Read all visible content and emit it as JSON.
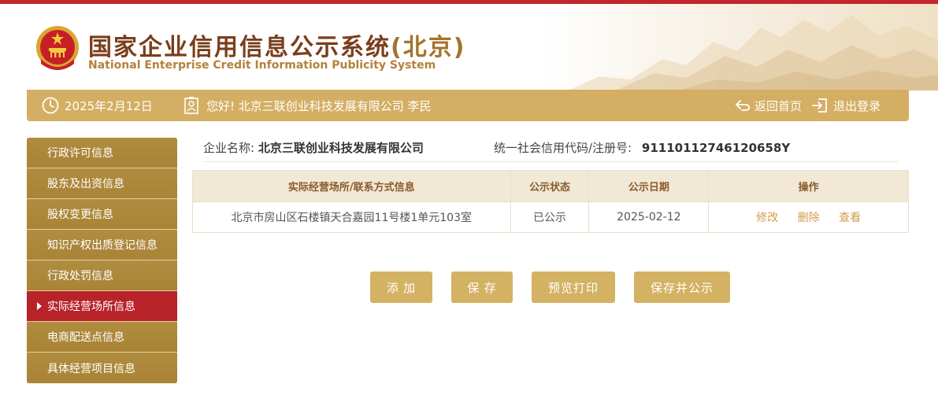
{
  "header": {
    "title_cn": "国家企业信用信息公示系统",
    "title_region": "(北京)",
    "title_en": "National Enterprise Credit Information Publicity System"
  },
  "topbar": {
    "date": "2025年2月12日",
    "greeting": "您好! 北京三联创业科技发展有限公司  李民",
    "back_home": "返回首页",
    "logout": "退出登录"
  },
  "sidebar": {
    "items": [
      {
        "label": "行政许可信息"
      },
      {
        "label": "股东及出资信息"
      },
      {
        "label": "股权变更信息"
      },
      {
        "label": "知识产权出质登记信息"
      },
      {
        "label": "行政处罚信息"
      },
      {
        "label": "实际经营场所信息",
        "active": true
      },
      {
        "label": "电商配送点信息"
      },
      {
        "label": "具体经营项目信息"
      }
    ]
  },
  "company": {
    "name_label": "企业名称:",
    "name_value": "北京三联创业科技发展有限公司",
    "code_label": "统一社会信用代码/注册号:",
    "code_value": "91110112746120658Y"
  },
  "table": {
    "headers": [
      "实际经营场所/联系方式信息",
      "公示状态",
      "公示日期",
      "操作"
    ],
    "rows": [
      {
        "address": "北京市房山区石楼镇天合嘉园11号楼1单元103室",
        "status": "已公示",
        "date": "2025-02-12"
      }
    ],
    "actions": {
      "edit": "修改",
      "delete": "删除",
      "view": "查看"
    }
  },
  "buttons": {
    "add": "添 加",
    "save": "保 存",
    "preview_print": "预览打印",
    "save_publish": "保存并公示"
  },
  "colors": {
    "accent_red": "#c1272d",
    "gold_bar": "#d4ae62",
    "sidebar_bg": "#b08c3f",
    "sidebar_active": "#b8232a",
    "table_header_bg": "#f1e8d6",
    "link_gold": "#d19c4c"
  }
}
